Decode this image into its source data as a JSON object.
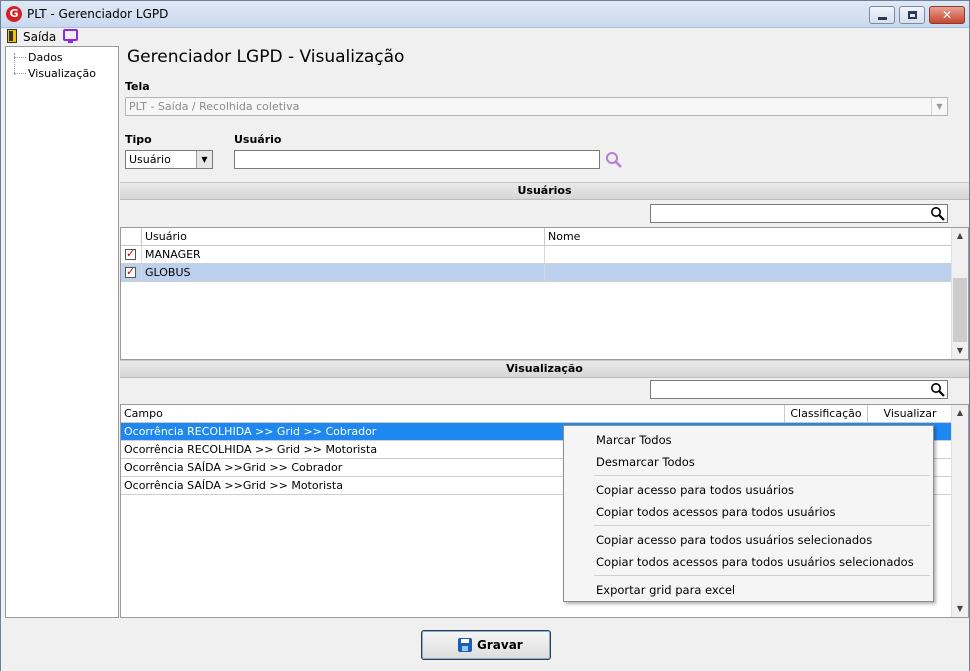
{
  "window": {
    "title": "PLT - Gerenciador LGPD",
    "close_glyph": "✕"
  },
  "menu": {
    "exit_label": "Saída"
  },
  "tree": {
    "items": [
      "Dados",
      "Visualização"
    ]
  },
  "page_title": "Gerenciador LGPD - Visualização",
  "tela": {
    "label": "Tela",
    "value": "PLT - Saída / Recolhida coletiva"
  },
  "tipo": {
    "label": "Tipo",
    "value": "Usuário"
  },
  "usuario": {
    "label": "Usuário",
    "value": ""
  },
  "users_section": {
    "title": "Usuários",
    "filter_value": "",
    "columns": [
      "Usuário",
      "Nome"
    ],
    "rows": [
      {
        "checked": true,
        "usuario": "MANAGER",
        "nome": ""
      },
      {
        "checked": true,
        "usuario": "GLOBUS",
        "nome": ""
      }
    ]
  },
  "view_section": {
    "title": "Visualização",
    "filter_value": "",
    "columns": [
      "Campo",
      "Classificação",
      "Visualizar"
    ],
    "rows": [
      {
        "campo": "Ocorrência RECOLHIDA >> Grid >> Cobrador"
      },
      {
        "campo": "Ocorrência RECOLHIDA >> Grid >> Motorista"
      },
      {
        "campo": "Ocorrência SAÍDA >>Grid >> Cobrador"
      },
      {
        "campo": "Ocorrência SAÍDA >>Grid >> Motorista"
      }
    ]
  },
  "context_menu": {
    "items": [
      "Marcar Todos",
      "Desmarcar Todos",
      "Copiar acesso para todos usuários",
      "Copiar todos acessos para todos usuários",
      "Copiar acesso para todos usuários selecionados",
      "Copiar todos acessos para todos usuários selecionados",
      "Exportar grid para excel"
    ]
  },
  "footer": {
    "save_label": "Gravar"
  },
  "colors": {
    "selection_blue": "#1e88f0",
    "selection_light": "#bcd1ee",
    "check_red": "#c00000",
    "search_lilac": "#b57edc"
  },
  "icons": [
    "app-g-icon",
    "exit-door-icon",
    "monitor-icon",
    "magnifier-icon",
    "floppy-disk-icon"
  ]
}
